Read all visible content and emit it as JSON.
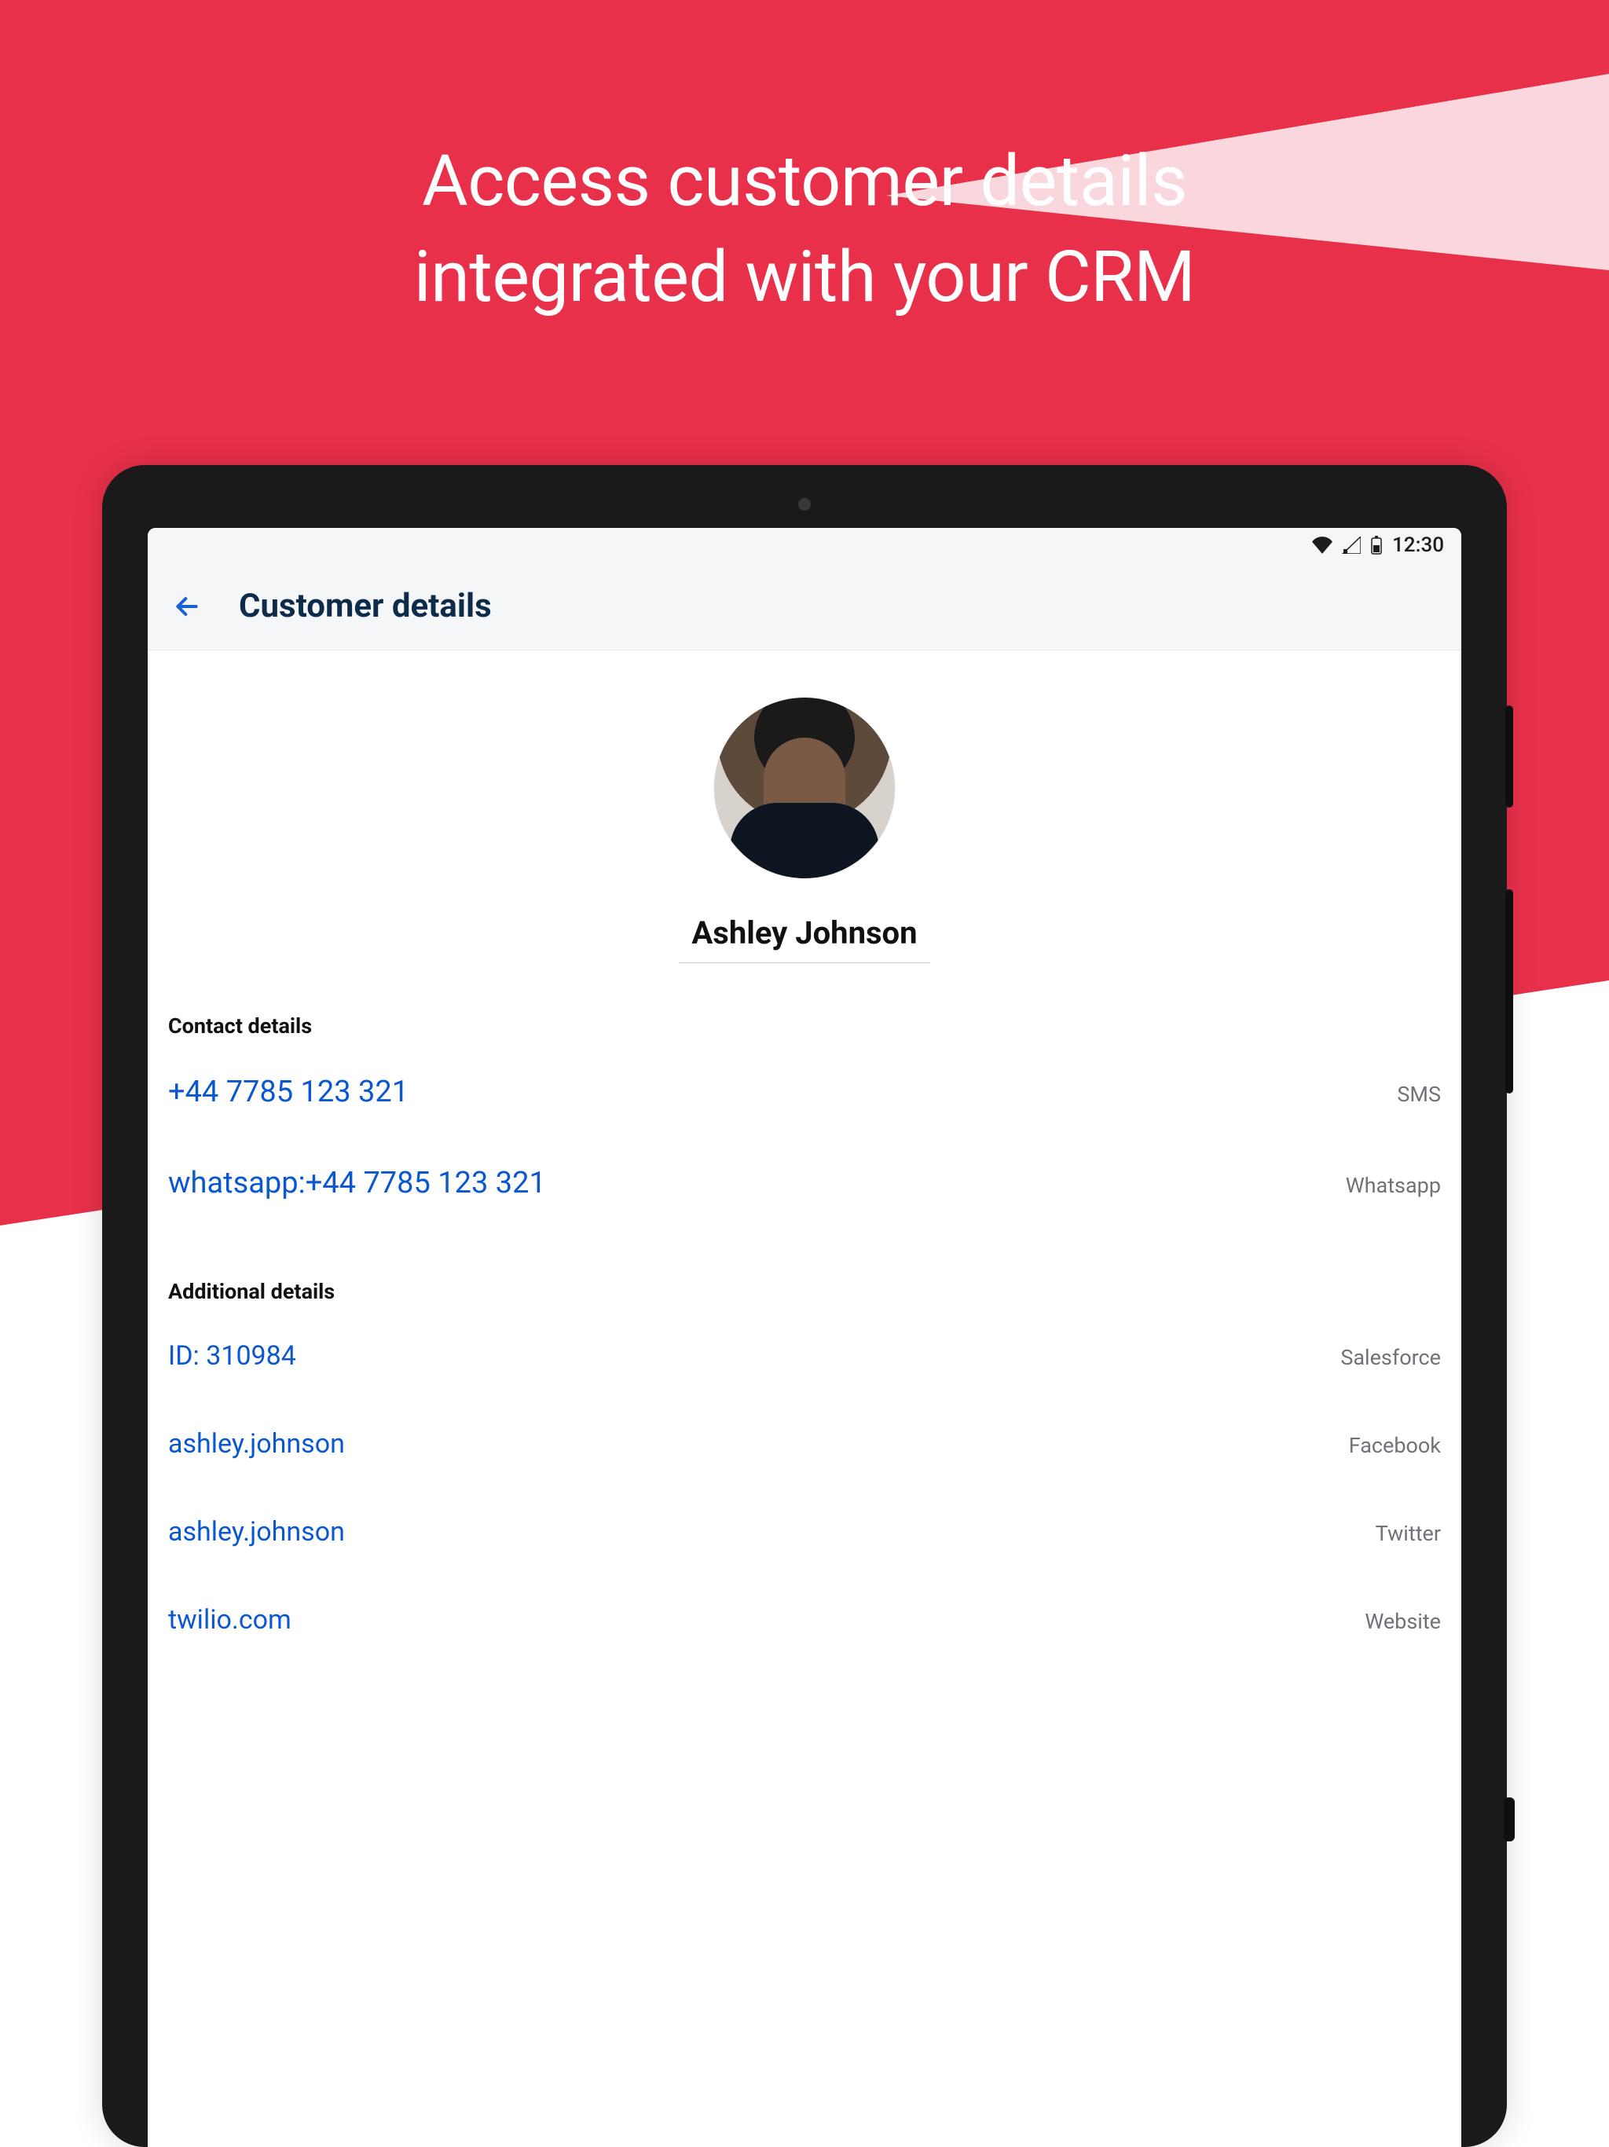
{
  "headline": {
    "line1": "Access customer details",
    "line2": "integrated with your CRM"
  },
  "status": {
    "time": "12:30"
  },
  "appbar": {
    "title": "Customer details"
  },
  "customer": {
    "name": "Ashley Johnson"
  },
  "sections": {
    "contact_label": "Contact details",
    "additional_label": "Additional details"
  },
  "contact": [
    {
      "value": "+44 7785 123 321",
      "tag": "SMS"
    },
    {
      "value": "whatsapp:+44 7785 123 321",
      "tag": "Whatsapp"
    }
  ],
  "additional": [
    {
      "value": "ID: 310984",
      "tag": "Salesforce"
    },
    {
      "value": "ashley.johnson",
      "tag": "Facebook"
    },
    {
      "value": "ashley.johnson",
      "tag": "Twitter"
    },
    {
      "value": "twilio.com",
      "tag": "Website"
    }
  ]
}
